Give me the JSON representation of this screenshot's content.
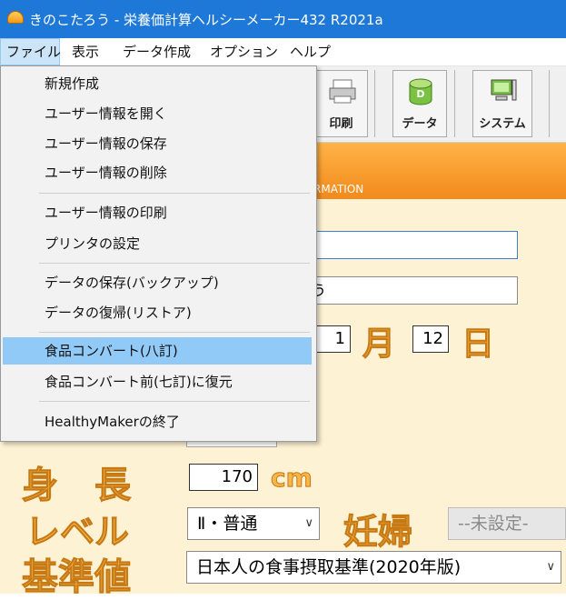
{
  "window": {
    "title": "きのこたろう - 栄養価計算ヘルシーメーカー432 R2021a"
  },
  "menubar": {
    "file": "ファイル",
    "view": "表示",
    "data_create": "データ作成",
    "options": "オプション",
    "help": "ヘルプ"
  },
  "toolbar": {
    "print": "印刷",
    "data": "データ",
    "system": "システム"
  },
  "banner": {
    "subtitle": "RMATION"
  },
  "form": {
    "name_partial": "う",
    "month_value": "1",
    "month_label": "月",
    "day_value": "12",
    "day_label": "日",
    "height_label": "身　長",
    "height_value": "170",
    "height_unit": "cm",
    "level_label": "レベル",
    "level_value": "Ⅱ・普通",
    "pregnancy_label": "妊婦",
    "pregnancy_value": "--未設定-",
    "standard_label": "基準値",
    "standard_value": "日本人の食事摂取基準(2020年版)"
  },
  "file_menu": {
    "items": [
      "新規作成",
      "ユーザー情報を開く",
      "ユーザー情報の保存",
      "ユーザー情報の削除",
      "ユーザー情報の印刷",
      "プリンタの設定",
      "データの保存(バックアップ)",
      "データの復帰(リストア)",
      "食品コンバート(八訂)",
      "食品コンバート前(七訂)に復元",
      "HealthyMakerの終了"
    ]
  }
}
